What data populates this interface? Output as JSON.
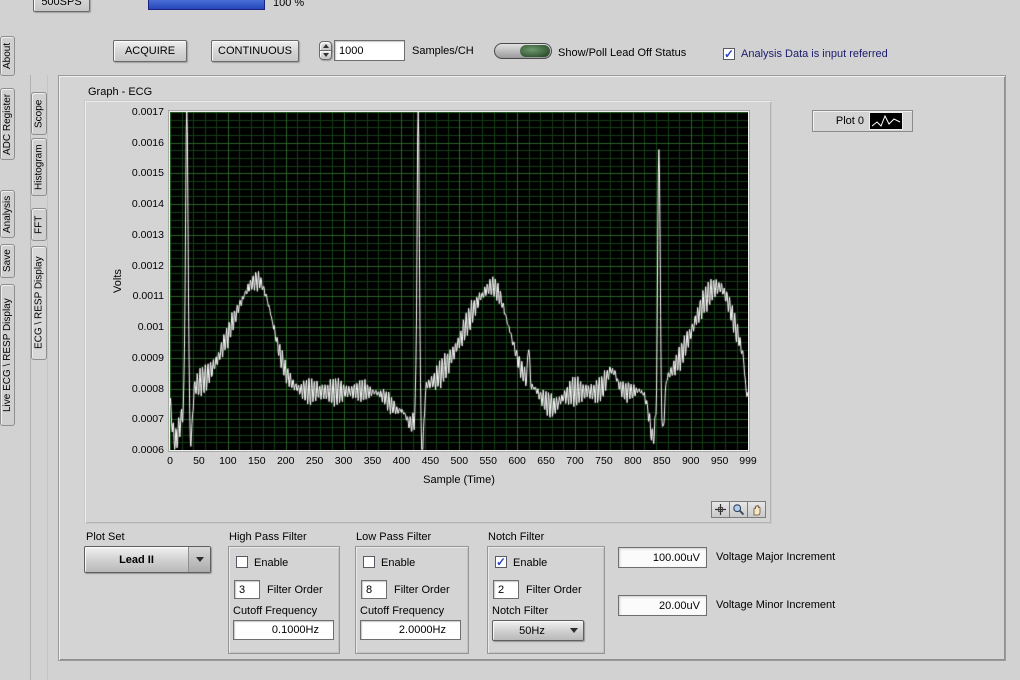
{
  "header": {
    "sps_button": "500SPS",
    "progress_label": "100 %"
  },
  "toolbar": {
    "acquire": "ACQUIRE",
    "continuous": "CONTINUOUS",
    "samples_value": "1000",
    "samples_label": "Samples/CH",
    "leadoff_label": "Show/Poll Lead Off Status",
    "analysis_ref_label": "Analysis Data is input referred",
    "analysis_ref_checked": true
  },
  "tabs": {
    "outer": [
      "About",
      "ADC Register",
      "Analysis",
      "Save",
      "Live ECG \\ RESP Display"
    ],
    "inner": [
      "Scope",
      "Histogram",
      "FFT",
      "ECG \\ RESP Display"
    ],
    "active": "ECG \\ RESP Display"
  },
  "graph": {
    "title": "Graph - ECG",
    "legend_label": "Plot 0"
  },
  "chart_data": {
    "type": "line",
    "title": "Graph - ECG",
    "xlabel": "Sample (Time)",
    "ylabel": "Volts",
    "xlim": [
      0,
      999
    ],
    "ylim": [
      0.0006,
      0.0017
    ],
    "x_ticks": [
      0,
      50,
      100,
      150,
      200,
      250,
      300,
      350,
      400,
      450,
      500,
      550,
      600,
      650,
      700,
      750,
      800,
      850,
      900,
      950,
      999
    ],
    "y_ticks": [
      "0.0017",
      "0.0016",
      "0.0015",
      "0.0014",
      "0.0013",
      "0.0012",
      "0.0011",
      "0.001",
      "0.0009",
      "0.0008",
      "0.0007",
      "0.0006"
    ],
    "legend": [
      "Plot 0"
    ],
    "legend_position": "top-right",
    "grid": true,
    "plot_bg": "#000000",
    "line_color": "#ffffff",
    "grid_minor_color": "#153c15",
    "grid_major_color": "#2a6428",
    "waveform": {
      "description": "ECG trace: 3 heartbeats, QRS spikes near samples 29/429/845 peaking ~0.0017/0.0017/0.0016 V, T-waves peaking ~0.00115 V near samples 152/558/948, noisy baseline ~0.0008 V, undershoot to ~0.0006 V after each QRS",
      "baseline": 0.00079,
      "noise_amplitude": 4.2e-05,
      "noise_period": 4.6,
      "beats": [
        {
          "qrs_x": 29,
          "qrs_peak": 0.00176,
          "qrs_width": 2.2,
          "undershoot": 0.00061,
          "t_peak_x": 152,
          "t_amp": 0.00036,
          "t_rise": 45,
          "t_fall": 26
        },
        {
          "qrs_x": 429,
          "qrs_peak": 0.00176,
          "qrs_width": 2.0,
          "undershoot": 0.00057,
          "t_peak_x": 558,
          "t_amp": 0.00034,
          "t_rise": 48,
          "t_fall": 28
        },
        {
          "qrs_x": 845,
          "qrs_peak": 0.00163,
          "qrs_width": 2.0,
          "undershoot": 0.00063,
          "t_peak_x": 948,
          "t_amp": 0.00034,
          "t_rise": 45,
          "t_fall": 30
        }
      ],
      "bumps": [
        {
          "x": 8,
          "amp": -0.00012,
          "sigma": 5
        },
        {
          "x": 395,
          "amp": -6e-05,
          "sigma": 16
        },
        {
          "x": 620,
          "amp": 0.00013,
          "sigma": 1.6
        },
        {
          "x": 660,
          "amp": -5e-05,
          "sigma": 14
        },
        {
          "x": 763,
          "amp": 7e-05,
          "sigma": 9
        },
        {
          "x": 835,
          "amp": -7e-05,
          "sigma": 5
        },
        {
          "x": 997,
          "amp": -0.0001,
          "sigma": 3
        }
      ]
    }
  },
  "controls": {
    "plot_set_label": "Plot Set",
    "plot_set_value": "Lead II",
    "high_pass": {
      "title": "High Pass Filter",
      "enable_label": "Enable",
      "enabled": false,
      "order_value": "3",
      "order_label": "Filter Order",
      "cutoff_label": "Cutoff Frequency",
      "cutoff_value": "0.1000Hz"
    },
    "low_pass": {
      "title": "Low Pass Filter",
      "enable_label": "Enable",
      "enabled": false,
      "order_value": "8",
      "order_label": "Filter Order",
      "cutoff_label": "Cutoff Frequency",
      "cutoff_value": "2.0000Hz"
    },
    "notch": {
      "title": "Notch Filter",
      "enable_label": "Enable",
      "enabled": true,
      "order_value": "2",
      "order_label": "Filter Order",
      "notch_label": "Notch Filter",
      "notch_value": "50Hz"
    },
    "voltage_major_value": "100.00uV",
    "voltage_major_label": "Voltage Major Increment",
    "voltage_minor_value": "20.00uV",
    "voltage_minor_label": "Voltage Minor Increment"
  }
}
